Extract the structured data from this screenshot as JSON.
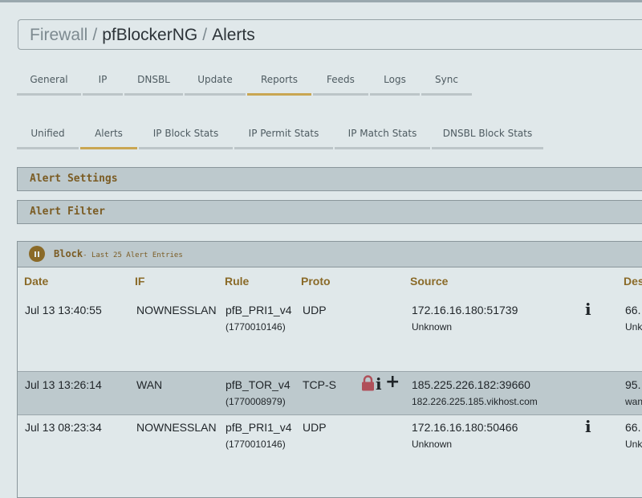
{
  "breadcrumb": {
    "item1": "Firewall",
    "sep1": "/",
    "item2": "pfBlockerNG",
    "sep2": "/",
    "item3": "Alerts"
  },
  "main_tabs": [
    "General",
    "IP",
    "DNSBL",
    "Update",
    "Reports",
    "Feeds",
    "Logs",
    "Sync"
  ],
  "main_tabs_active": "Reports",
  "sub_tabs": [
    "Unified",
    "Alerts",
    "IP Block Stats",
    "IP Permit Stats",
    "IP Match Stats",
    "DNSBL Block Stats"
  ],
  "sub_tabs_active": "Alerts",
  "panels": {
    "settings": "Alert Settings",
    "filter": "Alert Filter"
  },
  "block": {
    "title": "Block",
    "subtitle": "- Last 25 Alert Entries"
  },
  "columns": {
    "date": "Date",
    "if": "IF",
    "rule": "Rule",
    "proto": "Proto",
    "source": "Source",
    "dest": "Des"
  },
  "rows": [
    {
      "date": "Jul 13 13:40:55",
      "if": "NOWNESSLAN",
      "rule": "pfB_PRI1_v4",
      "rule_id": "(1770010146)",
      "proto": "UDP",
      "source": "172.16.16.180:51739",
      "source_host": "Unknown",
      "dest": "66.",
      "dest_host": "Unk",
      "icons": [
        "info-icon"
      ]
    },
    {
      "date": "Jul 13 13:26:14",
      "if": "WAN",
      "rule": "pfB_TOR_v4",
      "rule_id": "(1770008979)",
      "proto": "TCP-S",
      "source": "185.225.226.182:39660",
      "source_host": "182.226.225.185.vikhost.com",
      "dest": "95.",
      "dest_host": "wan",
      "icons": [
        "lock-icon",
        "info-icon",
        "plus-icon"
      ]
    },
    {
      "date": "Jul 13 08:23:34",
      "if": "NOWNESSLAN",
      "rule": "pfB_PRI1_v4",
      "rule_id": "(1770010146)",
      "proto": "UDP",
      "source": "172.16.16.180:50466",
      "source_host": "Unknown",
      "dest": "66.",
      "dest_host": "Unk",
      "icons": [
        "info-icon"
      ]
    }
  ],
  "glyphs": {
    "info": "i",
    "plus": "+"
  },
  "colors": {
    "accent": "#c9a652",
    "header_text": "#8a6a28",
    "lock": "#b0505a",
    "row_highlight": "#bdc9cd"
  }
}
